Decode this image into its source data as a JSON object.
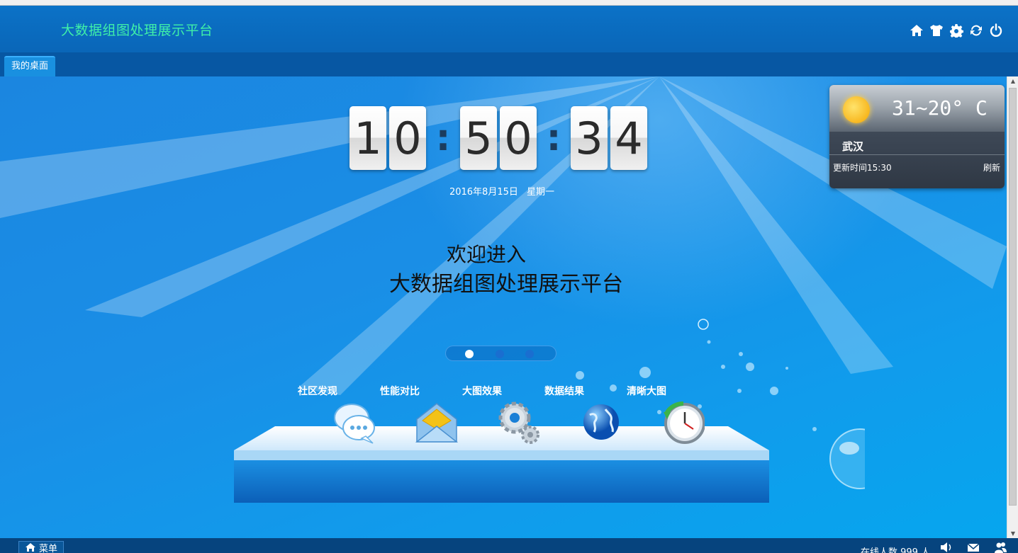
{
  "header": {
    "title": "大数据组图处理展示平台"
  },
  "header_icons": [
    "home-icon",
    "shirt-icon",
    "gear-icon",
    "refresh-icon",
    "power-icon"
  ],
  "tabs": [
    {
      "label": "我的桌面"
    }
  ],
  "clock": {
    "h1": "1",
    "h2": "0",
    "m1": "5",
    "m2": "0",
    "s1": "3",
    "s2": "4",
    "sep": ":"
  },
  "date": {
    "day": "2016年8月15日",
    "weekday": "星期一"
  },
  "welcome": {
    "line1": "欢迎进入",
    "line2": "大数据组图处理展示平台"
  },
  "pager": {
    "count": 3,
    "active": 0
  },
  "apps": [
    {
      "label": "社区发现",
      "icon": "chat-bubbles-icon"
    },
    {
      "label": "性能对比",
      "icon": "envelope-icon"
    },
    {
      "label": "大图效果",
      "icon": "gears-icon"
    },
    {
      "label": "数据结果",
      "icon": "globe-icon"
    },
    {
      "label": "清晰大图",
      "icon": "clock-icon"
    }
  ],
  "weather": {
    "temp": "31~20° C",
    "city": "武汉",
    "updated": "更新时间15:30",
    "refresh": "刷新"
  },
  "footer": {
    "menu": "菜单",
    "online": "在线人数 999 人"
  }
}
